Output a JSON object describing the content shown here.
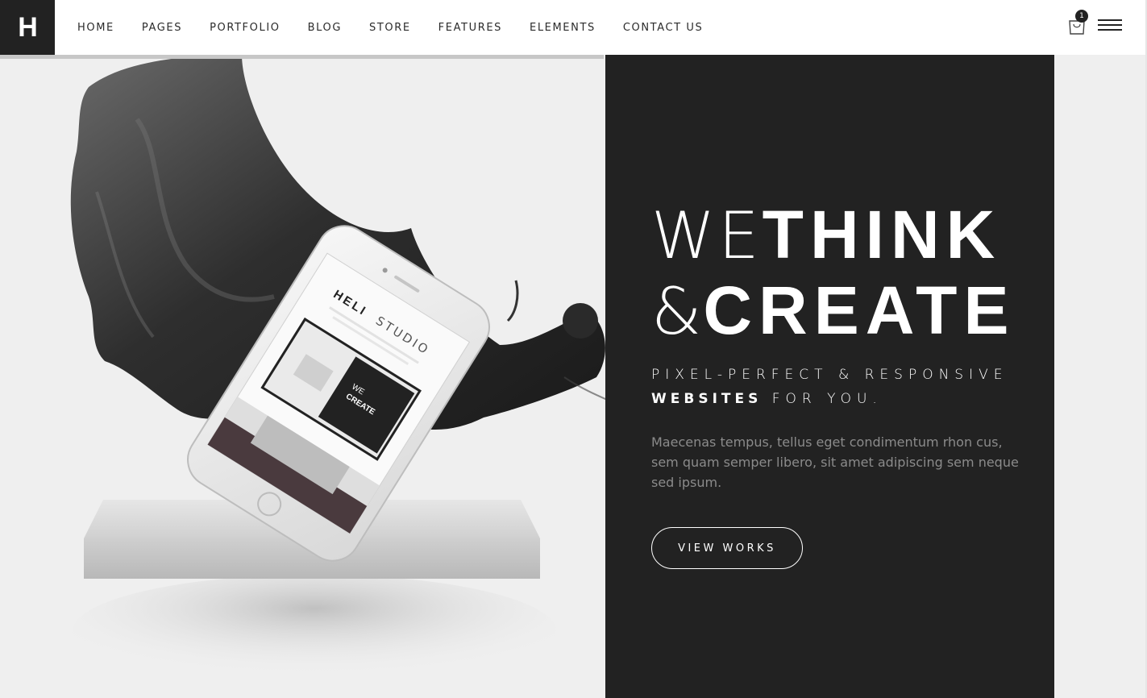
{
  "logo": {
    "text": "H"
  },
  "nav": {
    "items": [
      "HOME",
      "PAGES",
      "PORTFOLIO",
      "BLOG",
      "STORE",
      "FEATURES",
      "ELEMENTS",
      "CONTACT US"
    ]
  },
  "cart": {
    "icon": "shopping-bag-icon",
    "count": "1"
  },
  "menu": {
    "icon": "hamburger-menu-icon"
  },
  "hero": {
    "headline_thin_1": "WE",
    "headline_bold_1": "THINK",
    "headline_thin_2": "&",
    "headline_bold_2": "CREATE",
    "tagline_line1": "PIXEL-PERFECT & RESPONSIVE",
    "tagline_bold": "WEBSITES",
    "tagline_rest": "FOR YOU.",
    "lead": "Maecenas tempus, tellus eget condimentum rhon cus, sem quam semper libero, sit amet adipiscing sem neque sed ipsum.",
    "cta_label": "VIEW WORKS"
  },
  "phone_screen": {
    "brand_bold": "HELI",
    "brand_thin": "STUDIO",
    "mini_we": "WE",
    "mini_create": "CREATE"
  },
  "colors": {
    "dark_panel": "#222222",
    "light_bg": "#efefef",
    "accent_white": "#ffffff",
    "muted_text": "#8b8b8b"
  }
}
